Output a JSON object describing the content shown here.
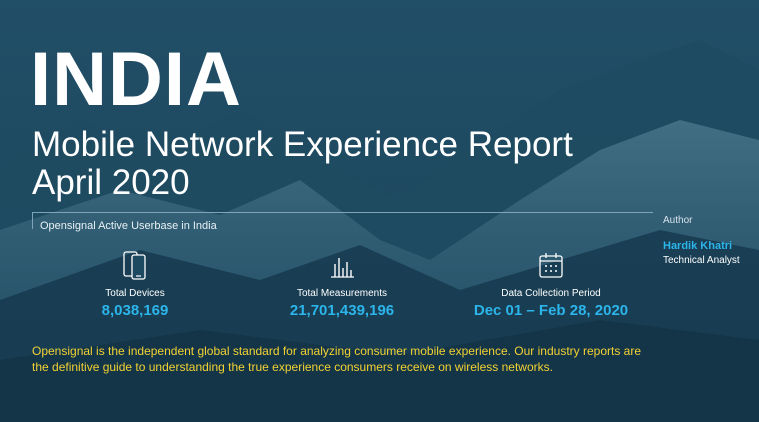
{
  "header": {
    "country": "INDIA",
    "subtitle_line1": "Mobile Network Experience Report",
    "subtitle_line2": "April 2020"
  },
  "section": {
    "label": "Opensignal Active Userbase in India"
  },
  "author": {
    "label": "Author",
    "name": "Hardik Khatri",
    "role": "Technical Analyst"
  },
  "stats": [
    {
      "label": "Total Devices",
      "value": "8,038,169",
      "icon": "smartphone-icon"
    },
    {
      "label": "Total Measurements",
      "value": "21,701,439,196",
      "icon": "bar-chart-icon"
    },
    {
      "label": "Data Collection Period",
      "value": "Dec 01 – Feb 28, 2020",
      "icon": "calendar-icon"
    }
  ],
  "footer": {
    "text": "Opensignal is the independent global standard for analyzing consumer mobile experience. Our industry reports are the definitive guide to understanding the true experience consumers receive on wireless networks."
  },
  "colors": {
    "accent": "#2bb5ea",
    "highlight": "#f2d232",
    "background": "#1a435a"
  }
}
